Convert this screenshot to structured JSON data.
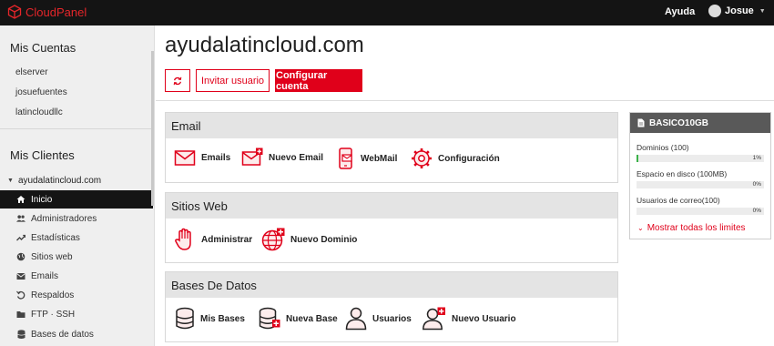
{
  "topbar": {
    "brand": "CloudPanel",
    "help": "Ayuda",
    "user": "Josue"
  },
  "sidebar": {
    "accounts_heading": "Mis Cuentas",
    "accounts": [
      "elserver",
      "josuefuentes",
      "latincloudllc"
    ],
    "clients_heading": "Mis Clientes",
    "client_domain": "ayudalatincloud.com",
    "items": [
      {
        "label": "Inicio",
        "icon": "home-icon",
        "active": true
      },
      {
        "label": "Administradores",
        "icon": "users-icon"
      },
      {
        "label": "Estadísticas",
        "icon": "trend-icon"
      },
      {
        "label": "Sitios web",
        "icon": "globe-icon"
      },
      {
        "label": "Emails",
        "icon": "mail-icon"
      },
      {
        "label": "Respaldos",
        "icon": "restore-icon"
      },
      {
        "label": "FTP · SSH",
        "icon": "folder-icon"
      },
      {
        "label": "Bases de datos",
        "icon": "database-icon"
      }
    ]
  },
  "main": {
    "title": "ayudalatincloud.com",
    "buttons": {
      "invite": "Invitar usuario",
      "configure": "Configurar cuenta"
    },
    "cards": {
      "email": {
        "title": "Email",
        "items": [
          "Emails",
          "Nuevo Email",
          "WebMail",
          "Configuración"
        ]
      },
      "sites": {
        "title": "Sitios Web",
        "items": [
          "Administrar",
          "Nuevo Dominio"
        ]
      },
      "db": {
        "title": "Bases De Datos",
        "items": [
          "Mis Bases",
          "Nueva Base",
          "Usuarios",
          "Nuevo Usuario"
        ]
      }
    }
  },
  "plan": {
    "name": "BASICO10GB",
    "rows": [
      {
        "label": "Dominios (100)",
        "percent": "1%",
        "fill": 0.01
      },
      {
        "label": "Espacio en disco (100MB)",
        "percent": "0%",
        "fill": 0
      },
      {
        "label": "Usuarios de correo(100)",
        "percent": "0%",
        "fill": 0
      }
    ],
    "more": "Mostrar todas los limites"
  },
  "colors": {
    "accent": "#e0001a",
    "topbar": "#141414",
    "sidebar": "#efefef",
    "progress": "#3cb34a"
  }
}
